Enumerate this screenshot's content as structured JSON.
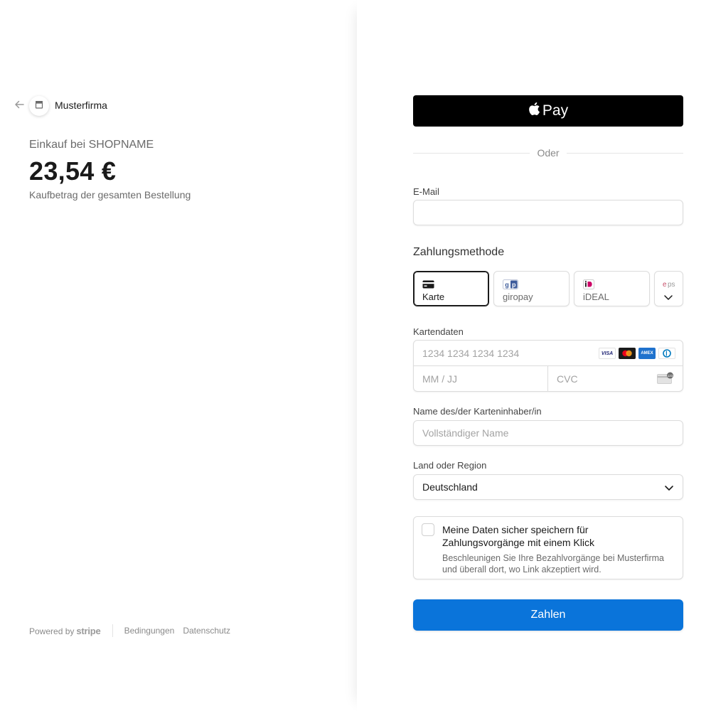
{
  "header": {
    "merchant_name": "Musterfirma",
    "back_icon": "arrow-left-icon",
    "logo_icon": "store-icon"
  },
  "summary": {
    "purchase_title": "Einkauf bei SHOPNAME",
    "amount": "23,54 €",
    "amount_description": "Kaufbetrag der gesamten Bestellung"
  },
  "footer": {
    "powered_by": "Powered by",
    "stripe": "stripe",
    "terms": "Bedingungen",
    "privacy": "Datenschutz"
  },
  "apple_pay": {
    "label": "Pay",
    "icon": "apple-icon"
  },
  "divider_text": "Oder",
  "email": {
    "label": "E-Mail",
    "value": ""
  },
  "payment_method": {
    "title": "Zahlungsmethode",
    "tabs": [
      {
        "label": "Karte",
        "icon": "card-icon",
        "active": true
      },
      {
        "label": "giropay",
        "icon": "giropay-icon",
        "active": false
      },
      {
        "label": "iDEAL",
        "icon": "ideal-icon",
        "active": false
      }
    ],
    "more_icon": "chevron-down-icon"
  },
  "card": {
    "label": "Kartendaten",
    "number_placeholder": "1234 1234 1234 1234",
    "expiry_placeholder": "MM / JJ",
    "cvc_placeholder": "CVC",
    "brands": [
      "VISA",
      "Mastercard",
      "AMEX",
      "Diners"
    ]
  },
  "cardholder": {
    "label": "Name des/der Karteninhaber/in",
    "placeholder": "Vollständiger Name"
  },
  "country": {
    "label": "Land oder Region",
    "value": "Deutschland"
  },
  "save_info": {
    "title": "Meine Daten sicher speichern für Zahlungsvorgänge mit einem Klick",
    "description": "Beschleunigen Sie Ihre Bezahlvorgänge bei Musterfirma und überall dort, wo Link akzeptiert wird.",
    "checked": false
  },
  "pay_button": {
    "label": "Zahlen",
    "color": "#0a74da"
  }
}
